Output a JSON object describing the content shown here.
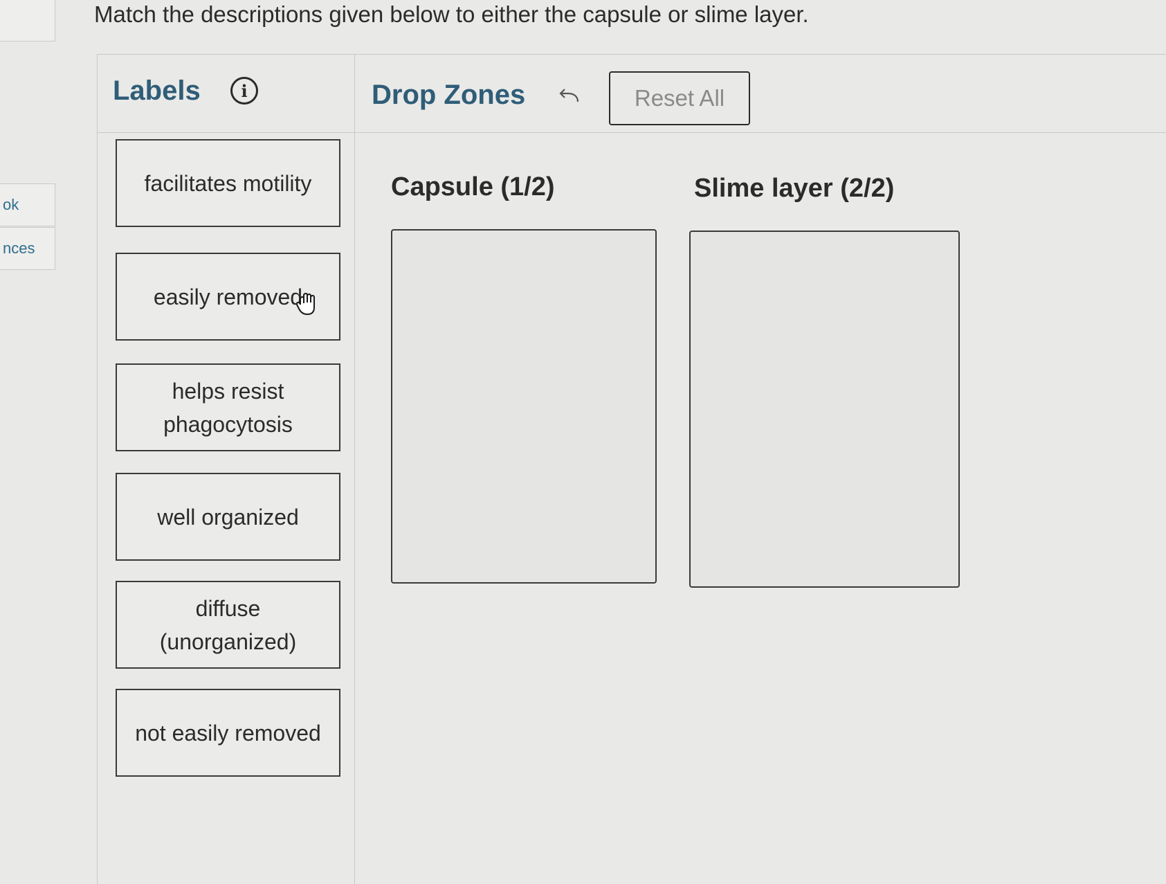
{
  "sidebar": {
    "tabs": [
      {
        "label": "ok"
      },
      {
        "label": "nces"
      }
    ]
  },
  "prompt": "Match the descriptions given below to either the capsule or slime layer.",
  "labels_panel": {
    "title": "Labels",
    "info_icon": "info-icon",
    "cards": [
      {
        "label": "facilitates motility"
      },
      {
        "label": "easily removed"
      },
      {
        "label": "helps resist phagocytosis"
      },
      {
        "label": "well organized"
      },
      {
        "label": "diffuse (unorganized)"
      },
      {
        "label": "not easily removed"
      }
    ]
  },
  "drop_zones_panel": {
    "title": "Drop Zones",
    "undo_icon": "undo-icon",
    "reset_label": "Reset All",
    "zones": [
      {
        "title": "Capsule (1/2)"
      },
      {
        "title": "Slime layer (2/2)"
      }
    ]
  },
  "cursor_icon": "hand-grab-icon",
  "colors": {
    "heading": "#2f5d78",
    "link": "#2f6e8e",
    "background": "#e9e9e7",
    "border": "#3a3a3a"
  }
}
